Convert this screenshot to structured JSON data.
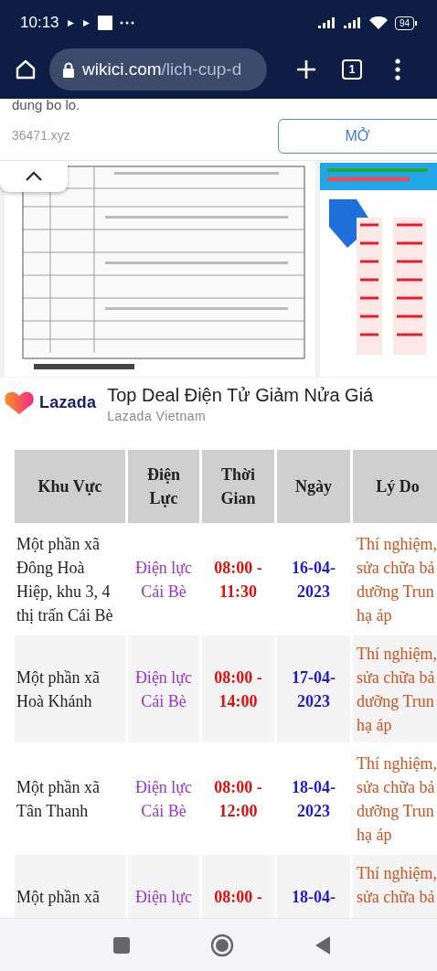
{
  "status_bar": {
    "time": "10:13",
    "battery": "94"
  },
  "browser": {
    "url_host": "wikici.com",
    "url_path": "/lich-cup-d",
    "tab_count": "1"
  },
  "ad_banner": {
    "text": "dung bo lo.",
    "domain": "36471.xyz",
    "button": "MỞ"
  },
  "sponsor": {
    "brand": "Lazada",
    "title": "Top Deal Điện Tử Giảm Nửa Giá",
    "subtitle": "Lazada Vietnam"
  },
  "table": {
    "columns": [
      [
        "Khu Vực"
      ],
      [
        "Điện",
        "Lực"
      ],
      [
        "Thời",
        "Gian"
      ],
      [
        "Ngày"
      ],
      [
        "Lý Do"
      ]
    ],
    "rows": [
      {
        "area": [
          "Một phần xã",
          "Đông Hoà",
          "Hiệp, khu 3, 4",
          "thị trấn Cái Bè"
        ],
        "unit": [
          "Điện lực",
          "Cái Bè"
        ],
        "time": [
          "08:00 -",
          "11:30"
        ],
        "date": [
          "16-04-",
          "2023"
        ],
        "reason": [
          "Thí nghiệm,",
          "sửa chữa bả",
          "dưỡng Trun",
          "hạ áp"
        ]
      },
      {
        "area": [
          "Một phần xã",
          "Hoà Khánh"
        ],
        "unit": [
          "Điện lực",
          "Cái Bè"
        ],
        "time": [
          "08:00 -",
          "14:00"
        ],
        "date": [
          "17-04-",
          "2023"
        ],
        "reason": [
          "Thí nghiệm,",
          "sửa chữa bả",
          "dưỡng Trun",
          "hạ áp"
        ]
      },
      {
        "area": [
          "Một phần xã",
          "Tân Thanh"
        ],
        "unit": [
          "Điện lực",
          "Cái Bè"
        ],
        "time": [
          "08:00 -",
          "12:00"
        ],
        "date": [
          "18-04-",
          "2023"
        ],
        "reason": [
          "Thí nghiệm,",
          "sửa chữa bả",
          "dưỡng Trun",
          "hạ áp"
        ]
      },
      {
        "area": [
          "Một phần xã"
        ],
        "unit": [
          "Điện lực"
        ],
        "time": [
          "08:00 -"
        ],
        "date": [
          "18-04-"
        ],
        "reason": [
          "Thí nghiệm,",
          "sửa chữa bả"
        ]
      }
    ]
  }
}
